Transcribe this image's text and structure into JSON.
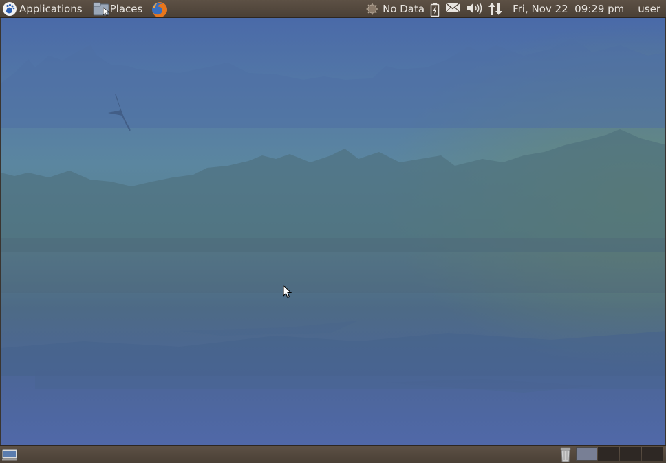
{
  "top_panel": {
    "applications_label": "Applications",
    "places_label": "Places",
    "icons": {
      "applications": "gnome-foot-icon",
      "places": "folder-icon",
      "browser": "firefox-icon"
    },
    "tray": {
      "weather_label": "No Data",
      "weather_icon": "weather-icon",
      "battery_icon": "battery-icon",
      "mail_icon": "envelope-icon",
      "volume_icon": "volume-icon",
      "network_icon": "network-arrows-icon"
    },
    "clock": "Fri, Nov 22  09:29 pm",
    "user": "user"
  },
  "desktop": {
    "wallpaper": "misty lake with forest and bird"
  },
  "bottom_panel": {
    "show_desktop_icon": "show-desktop-icon",
    "trash_icon": "trash-icon",
    "workspaces": [
      {
        "active": true
      },
      {
        "active": false
      },
      {
        "active": false
      },
      {
        "active": false
      }
    ]
  },
  "colors": {
    "panel": "#52473d",
    "panel_text": "#e8e4df",
    "workspace_active": "#787f95"
  }
}
